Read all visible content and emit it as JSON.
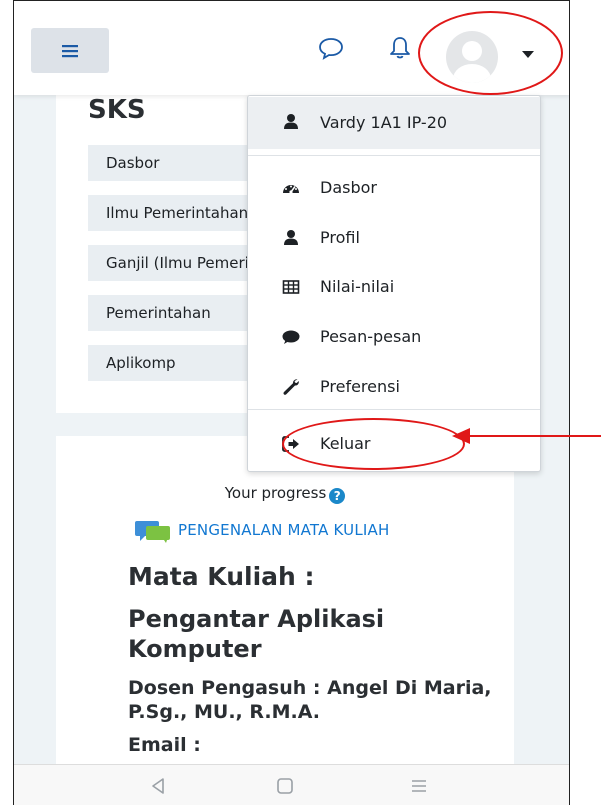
{
  "header": {
    "menu_icon": "hamburger-icon",
    "messages_icon": "chat-bubble-icon",
    "notifications_icon": "bell-icon",
    "avatar_icon": "user-avatar-icon",
    "caret_icon": "caret-down-icon"
  },
  "card1": {
    "title": "SKS",
    "breadcrumbs": [
      "Dasbor",
      "Ilmu Pemerintahan",
      "Ganjil (Ilmu Pemerintahan)",
      "Pemerintahan",
      "Aplikomp"
    ]
  },
  "user_menu": {
    "user_name": "Vardy 1A1 IP-20",
    "items": [
      {
        "label": "Dasbor",
        "icon": "dashboard-icon"
      },
      {
        "label": "Profil",
        "icon": "user-icon"
      },
      {
        "label": "Nilai-nilai",
        "icon": "grades-table-icon"
      },
      {
        "label": "Pesan-pesan",
        "icon": "comment-icon"
      },
      {
        "label": "Preferensi",
        "icon": "wrench-icon"
      }
    ],
    "logout_label": "Keluar",
    "logout_icon": "sign-out-icon"
  },
  "card2": {
    "progress_label": "Your progress",
    "progress_help": "?",
    "section_link": "PENGENALAN MATA KULIAH",
    "heading_mk": "Mata Kuliah :",
    "heading_course": "Pengantar Aplikasi Komputer",
    "heading_dosen": "Dosen Pengasuh : Angel Di Maria, P.Sg., MU., R.M.A.",
    "heading_email": "Email :"
  },
  "bottom_nav": {
    "back_icon": "back-triangle-icon",
    "home_icon": "home-square-icon",
    "recent_icon": "recent-lines-icon"
  },
  "annotation": {
    "color": "#e01818"
  }
}
